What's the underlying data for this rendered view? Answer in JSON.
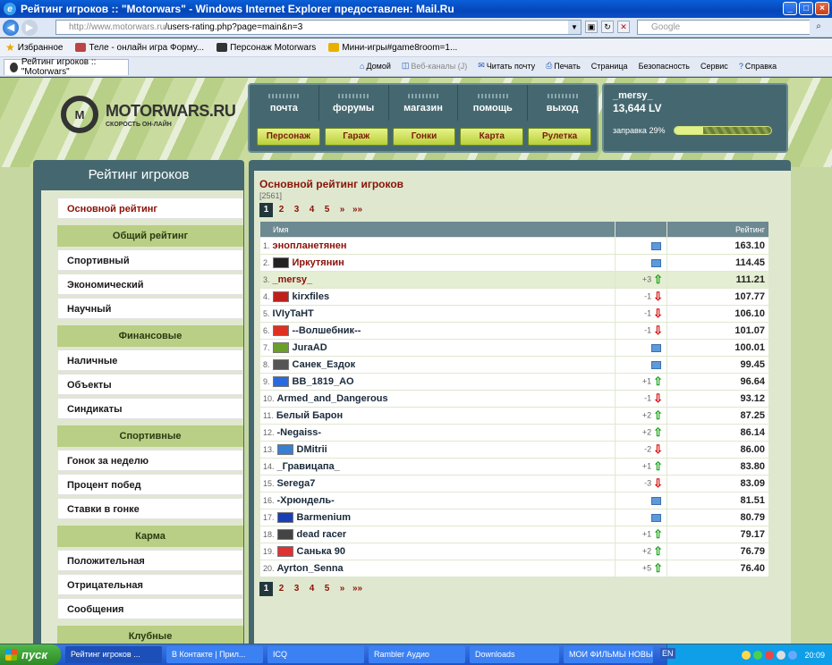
{
  "browser": {
    "title": "Рейтинг игроков :: \"Motorwars\" - Windows Internet Explorer предоставлен: Mail.Ru",
    "url_host": "http://www.motorwars.ru",
    "url_path": "/users-rating.php?page=main&n=3",
    "search_placeholder": "Google",
    "favorites_label": "Избранное",
    "fav_links": [
      "Теле - онлайн игра Форму...",
      "Персонаж Motorwars",
      "Мини-игры#game8room=1..."
    ],
    "tab_title": "Рейтинг игроков :: \"Motorwars\"",
    "commands": [
      "Домой",
      "Веб-каналы (J)",
      "Читать почту",
      "Печать",
      "Страница",
      "Безопасность",
      "Сервис",
      "Справка"
    ]
  },
  "site": {
    "brand": "MOTORWARS.RU",
    "slogan": "СКОРОСТЬ ОН-ЛАЙН",
    "nav_links": [
      "почта",
      "форумы",
      "магазин",
      "помощь",
      "выход"
    ],
    "nav_buttons": [
      "Персонаж",
      "Гараж",
      "Гонки",
      "Карта",
      "Рулетка"
    ],
    "user": {
      "name": "_mersy_",
      "lv": "13,644 LV",
      "fuel_label": "заправка 29%",
      "fuel_pct": 29
    }
  },
  "sidebar": {
    "title": "Рейтинг игроков",
    "main_item": "Основной рейтинг",
    "sections": [
      {
        "head": "Общий рейтинг",
        "items": [
          "Спортивный",
          "Экономический",
          "Научный"
        ]
      },
      {
        "head": "Финансовые",
        "items": [
          "Наличные",
          "Объекты",
          "Синдикаты"
        ]
      },
      {
        "head": "Спортивные",
        "items": [
          "Гонок за неделю",
          "Процент побед",
          "Ставки в гонке"
        ]
      },
      {
        "head": "Карма",
        "items": [
          "Положительная",
          "Отрицательная",
          "Сообщения"
        ]
      },
      {
        "head": "Клубные",
        "items": []
      }
    ]
  },
  "rating": {
    "title": "Основной рейтинг игроков",
    "count": "[2561]",
    "pages": [
      "1",
      "2",
      "3",
      "4",
      "5",
      "»",
      "»»"
    ],
    "col_name": "Имя",
    "col_score": "Рейтинг",
    "rows": [
      {
        "n": "1.",
        "name": "энопланетянен",
        "red": true,
        "av": "",
        "chg": "",
        "dir": "eq",
        "score": "163.10"
      },
      {
        "n": "2.",
        "name": "Иркутянин",
        "red": true,
        "av": "#222",
        "chg": "",
        "dir": "eq",
        "score": "114.45"
      },
      {
        "n": "3.",
        "name": "_mersy_",
        "red": true,
        "av": "",
        "chg": "+3",
        "dir": "up",
        "score": "111.21",
        "me": true
      },
      {
        "n": "4.",
        "name": "kirxfiles",
        "red": false,
        "av": "#c0201a",
        "chg": "-1",
        "dir": "dn",
        "score": "107.77"
      },
      {
        "n": "5.",
        "name": "IVIyTaHT",
        "red": false,
        "av": "",
        "chg": "-1",
        "dir": "dn",
        "score": "106.10"
      },
      {
        "n": "6.",
        "name": "--Волшебник--",
        "red": false,
        "av": "#e03020",
        "chg": "-1",
        "dir": "dn",
        "score": "101.07"
      },
      {
        "n": "7.",
        "name": "JuraAD",
        "red": false,
        "av": "#6a9e2a",
        "chg": "",
        "dir": "eq",
        "score": "100.01"
      },
      {
        "n": "8.",
        "name": "Санек_Ездок",
        "red": false,
        "av": "#555",
        "chg": "",
        "dir": "eq",
        "score": "99.45"
      },
      {
        "n": "9.",
        "name": "BB_1819_AO",
        "red": false,
        "av": "#2a6adf",
        "chg": "+1",
        "dir": "up",
        "score": "96.64"
      },
      {
        "n": "10.",
        "name": "Armed_and_Dangerous",
        "red": false,
        "av": "",
        "chg": "-1",
        "dir": "dn",
        "score": "93.12"
      },
      {
        "n": "11.",
        "name": "Белый Барон",
        "red": false,
        "av": "",
        "chg": "+2",
        "dir": "up",
        "score": "87.25"
      },
      {
        "n": "12.",
        "name": "-Negaiss-",
        "red": false,
        "av": "",
        "chg": "+2",
        "dir": "up",
        "score": "86.14"
      },
      {
        "n": "13.",
        "name": "DMitrii",
        "red": false,
        "av": "#3a7fd0",
        "chg": "-2",
        "dir": "dn",
        "score": "86.00"
      },
      {
        "n": "14.",
        "name": "_Гравицапа_",
        "red": false,
        "av": "",
        "chg": "+1",
        "dir": "up",
        "score": "83.80"
      },
      {
        "n": "15.",
        "name": "Serega7",
        "red": false,
        "av": "",
        "chg": "-3",
        "dir": "dn",
        "score": "83.09"
      },
      {
        "n": "16.",
        "name": "-Хрюндель-",
        "red": false,
        "av": "",
        "chg": "",
        "dir": "eq",
        "score": "81.51"
      },
      {
        "n": "17.",
        "name": "Barmenium",
        "red": false,
        "av": "#1a3fb5",
        "chg": "",
        "dir": "eq",
        "score": "80.79"
      },
      {
        "n": "18.",
        "name": "dead racer",
        "red": false,
        "av": "#444",
        "chg": "+1",
        "dir": "up",
        "score": "79.17"
      },
      {
        "n": "19.",
        "name": "Санька 90",
        "red": false,
        "av": "#d33",
        "chg": "+2",
        "dir": "up",
        "score": "76.79"
      },
      {
        "n": "20.",
        "name": "Ayrton_Senna",
        "red": false,
        "av": "",
        "chg": "+5",
        "dir": "up",
        "score": "76.40"
      }
    ]
  },
  "taskbar": {
    "start": "пуск",
    "items": [
      "Рейтинг игроков ...",
      "В Контакте | Прил...",
      "ICQ",
      "Rambler Аудио",
      "Downloads",
      "МОИ ФИЛЬМЫ НОВЫЕ"
    ],
    "lang": "EN",
    "clock": "20:09"
  }
}
